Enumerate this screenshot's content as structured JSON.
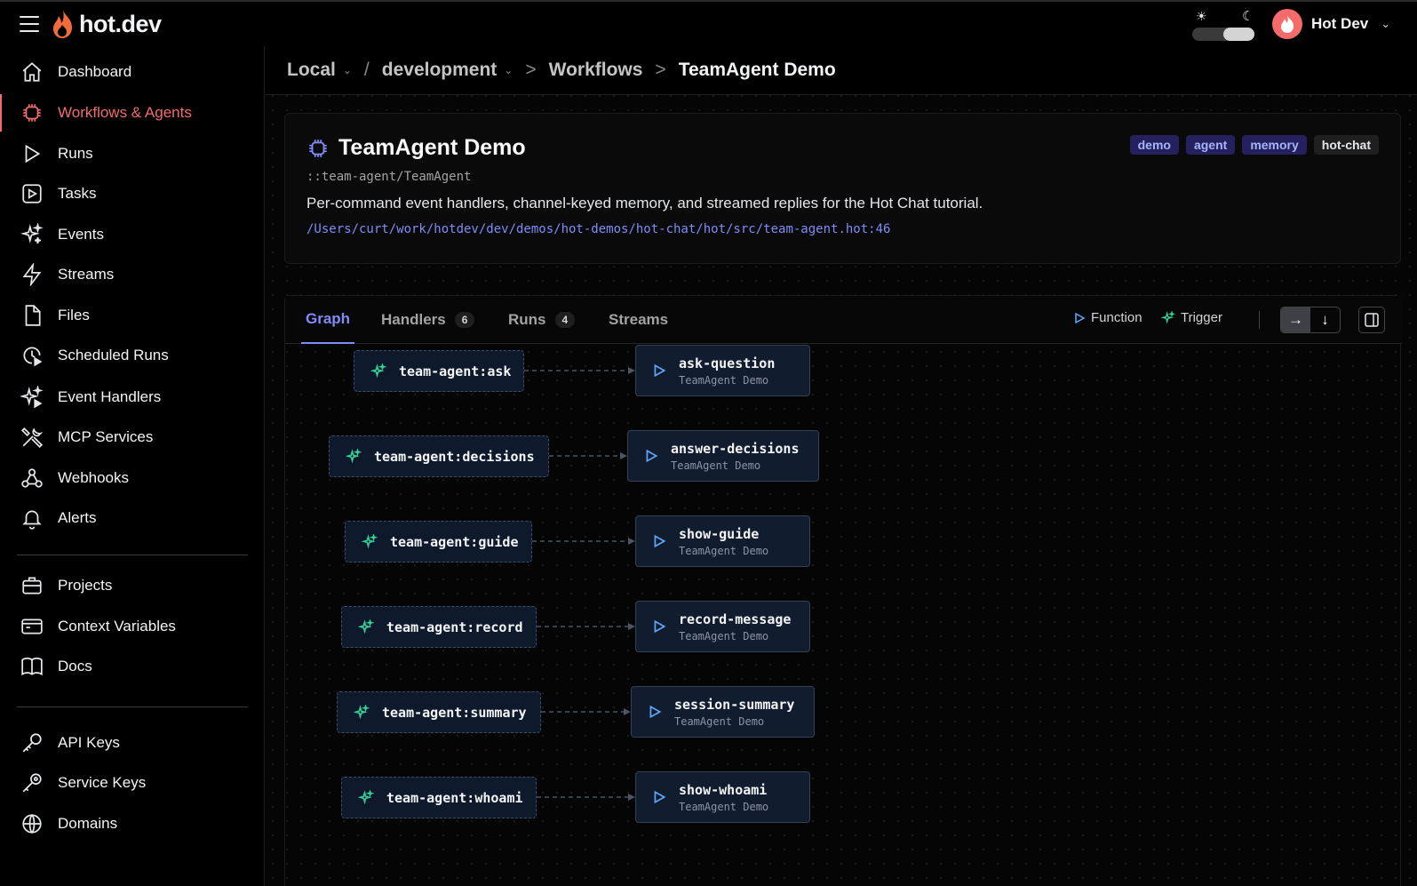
{
  "header": {
    "logo_text": "hot.dev",
    "user_name": "Hot Dev"
  },
  "sidebar": {
    "items": [
      {
        "label": "Dashboard",
        "icon": "home-icon"
      },
      {
        "label": "Workflows & Agents",
        "icon": "chip-icon",
        "active": true
      },
      {
        "label": "Runs",
        "icon": "play-icon"
      },
      {
        "label": "Tasks",
        "icon": "play-square-icon"
      },
      {
        "label": "Events",
        "icon": "sparkles-icon"
      },
      {
        "label": "Streams",
        "icon": "bolt-icon"
      },
      {
        "label": "Files",
        "icon": "file-icon"
      },
      {
        "label": "Scheduled Runs",
        "icon": "clock-play-icon"
      },
      {
        "label": "Event Handlers",
        "icon": "sparkles-play-icon"
      },
      {
        "label": "MCP Services",
        "icon": "tools-icon"
      },
      {
        "label": "Webhooks",
        "icon": "webhook-icon"
      },
      {
        "label": "Alerts",
        "icon": "bell-icon"
      },
      {
        "label": "Projects",
        "icon": "briefcase-icon"
      },
      {
        "label": "Context Variables",
        "icon": "context-icon"
      },
      {
        "label": "Docs",
        "icon": "book-icon"
      },
      {
        "label": "API Keys",
        "icon": "key-icon"
      },
      {
        "label": "Service Keys",
        "icon": "service-key-icon"
      },
      {
        "label": "Domains",
        "icon": "globe-icon"
      }
    ]
  },
  "breadcrumb": {
    "org": "Local",
    "env": "development",
    "section": "Workflows",
    "current": "TeamAgent Demo",
    "slash": "/",
    "sep": ">"
  },
  "workflow": {
    "title": "TeamAgent Demo",
    "path": "::team-agent/TeamAgent",
    "description": "Per-command event handlers, channel-keyed memory, and streamed replies for the Hot Chat tutorial.",
    "file": "/Users/curt/work/hotdev/dev/demos/hot-demos/hot-chat/hot/src/team-agent.hot:46",
    "tags": [
      "demo",
      "agent",
      "memory",
      "hot-chat"
    ]
  },
  "tabs": {
    "graph": "Graph",
    "handlers": "Handlers",
    "handlers_count": "6",
    "runs": "Runs",
    "runs_count": "4",
    "streams": "Streams"
  },
  "legend": {
    "function": "Function",
    "trigger": "Trigger"
  },
  "graph": {
    "edges": [
      {
        "trigger": "team-agent:ask",
        "function": "ask-question",
        "workflow": "TeamAgent Demo"
      },
      {
        "trigger": "team-agent:decisions",
        "function": "answer-decisions",
        "workflow": "TeamAgent Demo"
      },
      {
        "trigger": "team-agent:guide",
        "function": "show-guide",
        "workflow": "TeamAgent Demo"
      },
      {
        "trigger": "team-agent:record",
        "function": "record-message",
        "workflow": "TeamAgent Demo"
      },
      {
        "trigger": "team-agent:summary",
        "function": "session-summary",
        "workflow": "TeamAgent Demo"
      },
      {
        "trigger": "team-agent:whoami",
        "function": "show-whoami",
        "workflow": "TeamAgent Demo"
      }
    ]
  },
  "colors": {
    "accent": "#f26b6b",
    "tab_active": "#818cf8",
    "trigger_icon": "#34d399",
    "function_icon": "#60a5fa"
  }
}
